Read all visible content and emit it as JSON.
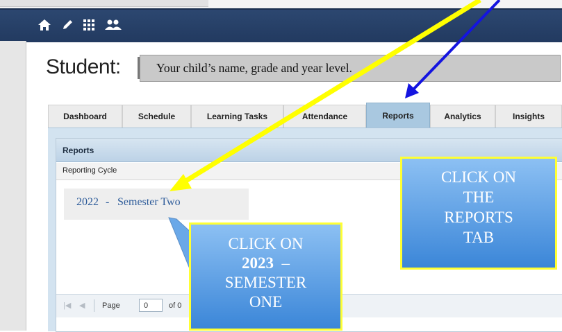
{
  "nav": {
    "icons": [
      "home-icon",
      "pencil-icon",
      "grid-icon",
      "people-icon"
    ]
  },
  "student": {
    "label": "Student:",
    "placeholder_text": "Your child’s name, grade and year level."
  },
  "tabs": [
    {
      "label": "Dashboard",
      "active": false
    },
    {
      "label": "Schedule",
      "active": false
    },
    {
      "label": "Learning Tasks",
      "active": false
    },
    {
      "label": "Attendance",
      "active": false
    },
    {
      "label": "Reports",
      "active": true
    },
    {
      "label": "Analytics",
      "active": false
    },
    {
      "label": "Insights",
      "active": false
    }
  ],
  "reports": {
    "header": "Reports",
    "column_header": "Reporting Cycle",
    "rows": [
      {
        "year": "2022",
        "separator": "-",
        "semester": "Semester Two"
      }
    ]
  },
  "pager": {
    "page_label": "Page",
    "page_value": "0",
    "of_label": "of 0"
  },
  "callouts": {
    "reports_tab": [
      "CLICK ON",
      "THE",
      "REPORTS",
      "TAB"
    ],
    "semester": {
      "line1": "CLICK ON",
      "year": "2023",
      "dash": "–",
      "line3": "SEMESTER",
      "line4": "ONE"
    }
  },
  "colors": {
    "navbar": "#223a60",
    "active_tab": "#a9c8e0",
    "callout_fill": "#5a9ce4",
    "callout_border": "#ffff33",
    "yellow_arrow": "#ffff00",
    "blue_arrow": "#1414e0",
    "link": "#2e5c9a"
  }
}
